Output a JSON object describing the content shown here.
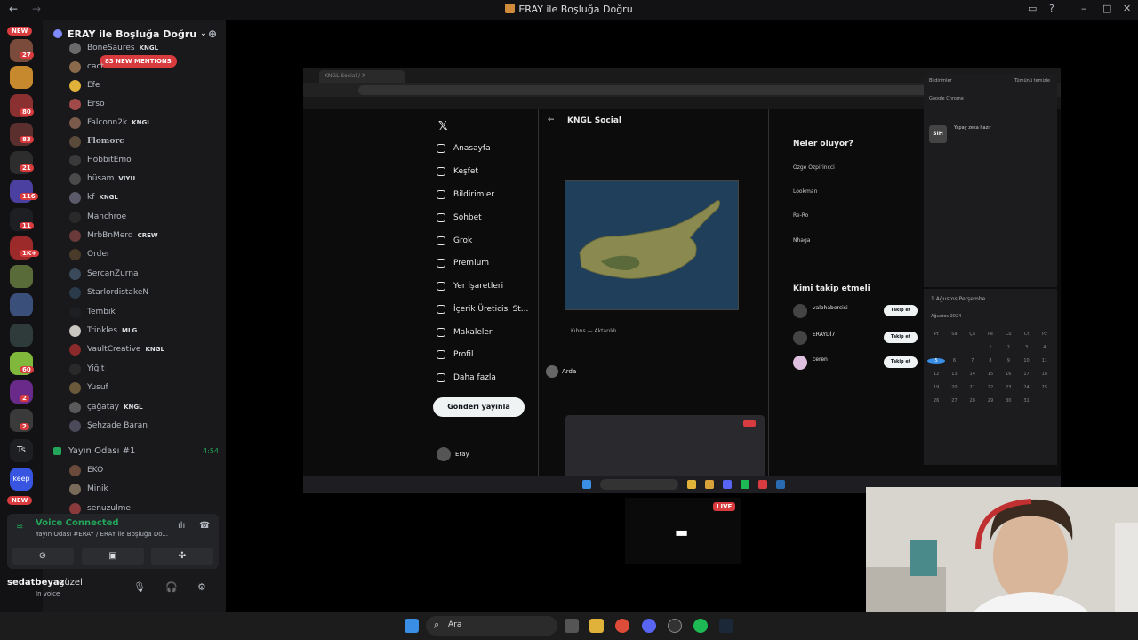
{
  "window": {
    "title": "ERAY ile Boşluğa Doğru",
    "back_icon": "arrow-left-icon",
    "forward_icon": "arrow-right-icon",
    "inbox_icon": "inbox-icon",
    "help_icon": "help-icon",
    "minimize": "–",
    "maximize": "□",
    "close": "✕"
  },
  "guilds": {
    "new_label": "NEW",
    "badges": [
      "27",
      "80",
      "83",
      "21",
      "116",
      "11",
      "1K+",
      "60",
      "2",
      "2"
    ],
    "ts_label": "Ts",
    "keep_label": "keep"
  },
  "server": {
    "name": "ERAY ile Boşluğa Doğru",
    "mentions_label": "83 NEW MENTIONS"
  },
  "users": [
    {
      "name": "BoneSaures",
      "tag": "KNGL"
    },
    {
      "name": "cact",
      "tag": ""
    },
    {
      "name": "Efe",
      "tag": ""
    },
    {
      "name": "Erso",
      "tag": ""
    },
    {
      "name": "Falconn2k",
      "tag": "KNGL"
    },
    {
      "name": "Flomorc",
      "tag": ""
    },
    {
      "name": "HobbitEmo",
      "tag": ""
    },
    {
      "name": "hüsam",
      "tag": "VIYU"
    },
    {
      "name": "kf",
      "tag": "KNGL"
    },
    {
      "name": "Manchroe",
      "tag": ""
    },
    {
      "name": "MrbBnMerd",
      "tag": "CREW"
    },
    {
      "name": "Order",
      "tag": ""
    },
    {
      "name": "SercanZurna",
      "tag": ""
    },
    {
      "name": "StarlordistakeN",
      "tag": ""
    },
    {
      "name": "Tembik",
      "tag": ""
    },
    {
      "name": "Trinkles",
      "tag": "MLG"
    },
    {
      "name": "VaultCreative",
      "tag": "KNGL"
    },
    {
      "name": "Yiğit",
      "tag": ""
    },
    {
      "name": "Yusuf",
      "tag": ""
    },
    {
      "name": "çağatay",
      "tag": "KNGL"
    },
    {
      "name": "Şehzade Baran",
      "tag": ""
    }
  ],
  "voice_channel": {
    "name": "Yayın Odası #1",
    "time": "4:54",
    "users": [
      "EKO",
      "Minik",
      "senuzulme"
    ]
  },
  "voice_panel": {
    "status": "Voice Connected",
    "location": "Yayın Odası #ERAY / ERAY ile Boşluğa Do...",
    "username": "sedatbeyaz",
    "overlay_name": "güzel",
    "user_status": "In voice"
  },
  "stream": {
    "live_label": "LIVE",
    "browser_tab": "KNGL Social / X",
    "x_nav": [
      "Anasayfa",
      "Keşfet",
      "Bildirimler",
      "Sohbet",
      "Grok",
      "Premium",
      "Yer İşaretleri",
      "İçerik Üreticisi St...",
      "Makaleler",
      "Profil",
      "Daha fazla"
    ],
    "post_button": "Gönderi yayınla",
    "profile_name": "Eray",
    "feed_title": "KNGL Social",
    "feed_caption": "Kıbrıs — Aktarıldı",
    "reply_name": "Arda",
    "trends_title": "Neler oluyor?",
    "trends": [
      "Özge Özpirinçci",
      "Lookman",
      "Re-Ro",
      "Nhaga"
    ],
    "follow_title": "Kimi takip etmeli",
    "follow_people": [
      "valohabercisi",
      "ERAYDİ7",
      "ceren"
    ],
    "follow_button": "Takip et",
    "notif_header": "Bildirimler",
    "notif_clear": "Tümünü temizle",
    "notif_app": "Google Chrome",
    "notif_icon": "SIH",
    "notif_text": "Yapay zeka hazır",
    "calendar_header": "1 Ağustos Perşembe",
    "calendar_month": "Ağustos 2024",
    "calendar_days": [
      "Pt",
      "Sa",
      "Ça",
      "Pe",
      "Cu",
      "Ct",
      "Pz",
      "",
      "",
      "",
      "1",
      "2",
      "3",
      "4",
      "5",
      "6",
      "7",
      "8",
      "9",
      "10",
      "11",
      "12",
      "13",
      "14",
      "15",
      "16",
      "17",
      "18",
      "19",
      "20",
      "21",
      "22",
      "23",
      "24",
      "25",
      "26",
      "27",
      "28",
      "29",
      "30",
      "31",
      ""
    ],
    "calendar_highlight": "5"
  },
  "taskbar": {
    "search_label": "Ara"
  }
}
